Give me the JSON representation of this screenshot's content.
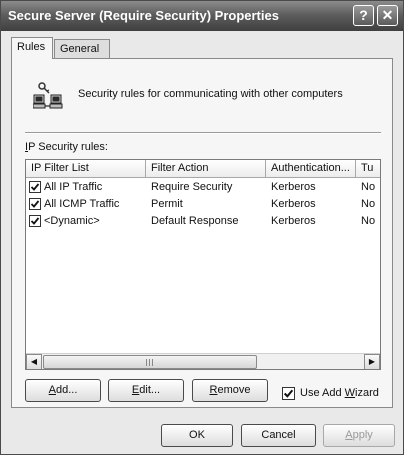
{
  "window": {
    "title": "Secure Server (Require Security) Properties",
    "help_glyph": "?",
    "close_glyph": "✕"
  },
  "tabs": [
    {
      "label": "Rules",
      "active": true
    },
    {
      "label": "General",
      "active": false
    }
  ],
  "rules_tab": {
    "icon": "network-computers-icon",
    "description": "Security rules for communicating with other computers",
    "list_label_prefix": "I",
    "list_label_rest": "P Security rules:",
    "columns": [
      "IP Filter List",
      "Filter Action",
      "Authentication...",
      "Tu"
    ],
    "rows": [
      {
        "checked": true,
        "filter_list": "All IP Traffic",
        "filter_action": "Require Security",
        "authentication": "Kerberos",
        "tunnel": "No"
      },
      {
        "checked": true,
        "filter_list": "All ICMP Traffic",
        "filter_action": "Permit",
        "authentication": "Kerberos",
        "tunnel": "No"
      },
      {
        "checked": true,
        "filter_list": "<Dynamic>",
        "filter_action": "Default Response",
        "authentication": "Kerberos",
        "tunnel": "No"
      }
    ],
    "buttons": {
      "add": {
        "mnemonic": "A",
        "rest": "dd..."
      },
      "edit": {
        "mnemonic": "E",
        "rest": "dit..."
      },
      "remove": {
        "mnemonic": "R",
        "rest": "emove"
      }
    },
    "use_add_wizard": {
      "checked": true,
      "prefix": "Use Add ",
      "mnemonic": "W",
      "rest": "izard"
    }
  },
  "dialog_buttons": {
    "ok": "OK",
    "cancel": "Cancel",
    "apply_mnemonic": "A",
    "apply_rest": "pply"
  }
}
